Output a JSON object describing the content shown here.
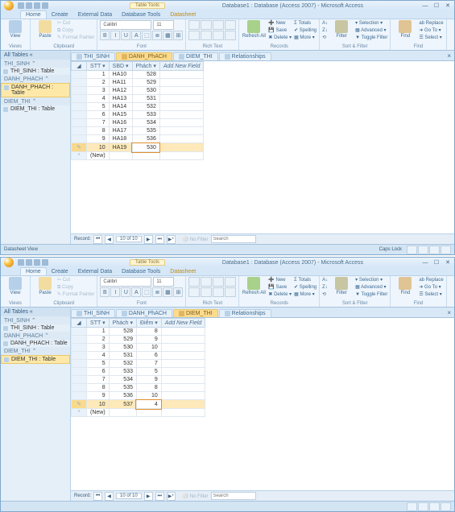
{
  "app": {
    "title_center": "Database1 : Database (Access 2007) - Microsoft Access",
    "table_tools": "Table Tools"
  },
  "ribbon": {
    "tabs": [
      "Home",
      "Create",
      "External Data",
      "Database Tools",
      "Datasheet"
    ],
    "active_tab": "Home",
    "views_label": "Views",
    "view": "View",
    "clipboard_label": "Clipboard",
    "paste": "Paste",
    "cut": "Cut",
    "copy": "Copy",
    "format_painter": "Format Painter",
    "font_label": "Font",
    "font_name": "Calibri",
    "font_size": "11",
    "richtext_label": "Rich Text",
    "records_label": "Records",
    "refresh": "Refresh All",
    "new": "New",
    "save": "Save",
    "delete": "Delete",
    "totals": "Totals",
    "spelling": "Spelling",
    "more": "More",
    "sortfilter_label": "Sort & Filter",
    "filter": "Filter",
    "selection": "Selection",
    "advanced": "Advanced",
    "toggle_filter": "Toggle Filter",
    "find_label": "Find",
    "find": "Find",
    "replace": "Replace",
    "goto": "Go To",
    "select": "Select"
  },
  "nav": {
    "header": "All Tables",
    "groups": [
      {
        "title": "THI_SINH",
        "items": [
          "THI_SINH : Table"
        ]
      },
      {
        "title": "DANH_PHACH",
        "items": [
          "DANH_PHACH : Table"
        ]
      },
      {
        "title": "DIEM_THI",
        "items": [
          "DIEM_THI : Table"
        ]
      }
    ]
  },
  "chart_data": [
    {
      "type": "table",
      "title": "DANH_PhACH",
      "columns": [
        "STT",
        "SBD",
        "Phách"
      ],
      "rows": [
        [
          1,
          "HA10",
          528
        ],
        [
          2,
          "HA11",
          529
        ],
        [
          3,
          "HA12",
          530
        ],
        [
          4,
          "HA13",
          531
        ],
        [
          5,
          "HA14",
          532
        ],
        [
          6,
          "HA15",
          533
        ],
        [
          7,
          "HA16",
          534
        ],
        [
          8,
          "HA17",
          535
        ],
        [
          9,
          "HA18",
          536
        ],
        [
          10,
          "HA19",
          530
        ]
      ]
    },
    {
      "type": "table",
      "title": "DIEM_THI",
      "columns": [
        "STT",
        "Phách",
        "Điểm"
      ],
      "rows": [
        [
          1,
          528,
          8
        ],
        [
          2,
          529,
          9
        ],
        [
          3,
          530,
          10
        ],
        [
          4,
          531,
          6
        ],
        [
          5,
          532,
          7
        ],
        [
          6,
          533,
          5
        ],
        [
          7,
          534,
          9
        ],
        [
          8,
          535,
          8
        ],
        [
          9,
          536,
          10
        ],
        [
          10,
          537,
          4
        ]
      ]
    }
  ],
  "windows": [
    {
      "nav_selected_group": 1,
      "object_tabs": [
        "THI_SINH",
        "DANH_PhACH",
        "DIEM_THI",
        "Relationships"
      ],
      "active_object_tab": 1,
      "sheet_idx": 0,
      "selected_row": 9,
      "edit_col": 2,
      "add_field": "Add New Field",
      "new_row": "(New)",
      "record_nav": {
        "label": "Record:",
        "pos": "10 of 10",
        "no_filter": "No Filter",
        "search": "Search"
      },
      "status_left": "Datasheet View",
      "status_right": "Caps Lock"
    },
    {
      "nav_selected_group": 2,
      "object_tabs": [
        "THI_SINH",
        "DANH_PhACH",
        "DIEM_THI",
        "Relationships"
      ],
      "active_object_tab": 2,
      "sheet_idx": 1,
      "selected_row": 9,
      "edit_col": 2,
      "add_field": "Add New Field",
      "new_row": "(New)",
      "record_nav": {
        "label": "Record:",
        "pos": "10 of 10",
        "no_filter": "No Filter",
        "search": "Search"
      },
      "status_left": "",
      "status_right": ""
    }
  ]
}
